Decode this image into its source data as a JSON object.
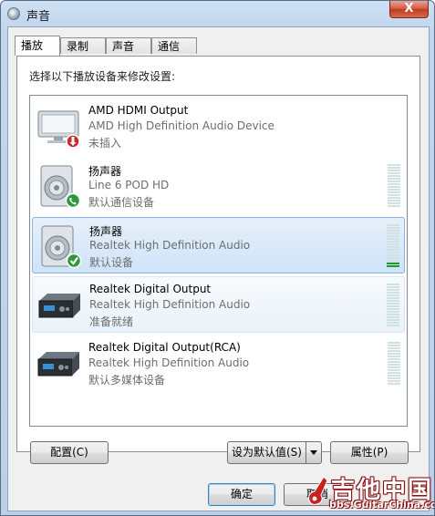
{
  "window": {
    "title": "声音",
    "close_glyph": "X"
  },
  "tabs": [
    {
      "label": "播放",
      "active": true
    },
    {
      "label": "录制",
      "active": false
    },
    {
      "label": "声音",
      "active": false
    },
    {
      "label": "通信",
      "active": false
    }
  ],
  "instruction": "选择以下播放设备来修改设置:",
  "devices": [
    {
      "name": "AMD HDMI Output",
      "description": "AMD High Definition Audio Device",
      "status": "未插入",
      "icon": "monitor-icon",
      "badge": "unplugged-badge-icon",
      "meter_level": 0
    },
    {
      "name": "扬声器",
      "description": "Line 6 POD HD",
      "status": "默认通信设备",
      "icon": "speaker-icon",
      "badge": "phone-badge-icon",
      "meter_level": 0
    },
    {
      "name": "扬声器",
      "description": "Realtek High Definition Audio",
      "status": "默认设备",
      "icon": "speaker-icon",
      "badge": "default-check-badge-icon",
      "meter_level": 0.12
    },
    {
      "name": "Realtek Digital Output",
      "description": "Realtek High Definition Audio",
      "status": "准备就绪",
      "icon": "digital-output-icon",
      "badge": "",
      "meter_level": 0
    },
    {
      "name": "Realtek Digital Output(RCA)",
      "description": "Realtek High Definition Audio",
      "status": "默认多媒体设备",
      "icon": "digital-output-icon",
      "badge": "",
      "meter_level": 0
    }
  ],
  "buttons": {
    "configure": "配置(C)",
    "set_default": "设为默认值(S)",
    "properties": "属性(P)",
    "ok": "确定",
    "cancel": "取消"
  },
  "watermark": {
    "text": "吉他中国",
    "url": "bbs.GuitarChina.com"
  },
  "colors": {
    "meter_on": "#1e9a2c",
    "meter_off": "#cfe1e3",
    "selection": "#cfe3f7"
  }
}
